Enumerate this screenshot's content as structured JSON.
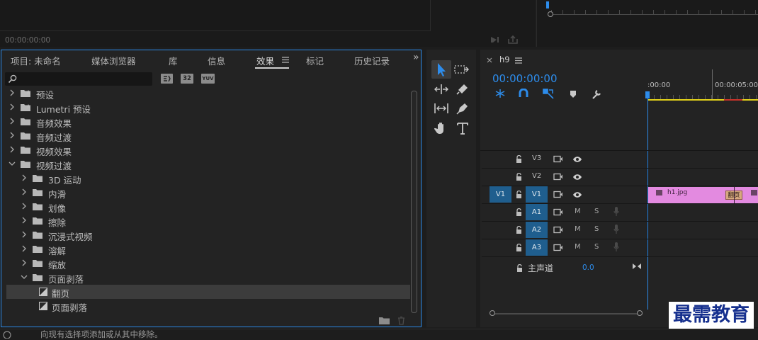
{
  "monitor": {
    "timecode": "00:00:00:00"
  },
  "effects_panel": {
    "tabs": [
      {
        "label": "项目: 未命名"
      },
      {
        "label": "媒体浏览器"
      },
      {
        "label": "库"
      },
      {
        "label": "信息"
      },
      {
        "label": "效果",
        "active": true
      },
      {
        "label": "标记"
      },
      {
        "label": "历史记录"
      }
    ],
    "more": "»",
    "search": {
      "value": "",
      "placeholder": ""
    },
    "filter_buttons": [
      "32",
      "YUV"
    ],
    "tree": [
      {
        "label": "预设",
        "level": 0,
        "expanded": false,
        "icon": "preset-folder-icon"
      },
      {
        "label": "Lumetri 预设",
        "level": 0,
        "expanded": false,
        "icon": "preset-folder-icon"
      },
      {
        "label": "音频效果",
        "level": 0,
        "expanded": false,
        "icon": "folder-icon"
      },
      {
        "label": "音频过渡",
        "level": 0,
        "expanded": false,
        "icon": "folder-icon"
      },
      {
        "label": "视频效果",
        "level": 0,
        "expanded": false,
        "icon": "folder-icon"
      },
      {
        "label": "视频过渡",
        "level": 0,
        "expanded": true,
        "icon": "folder-icon"
      },
      {
        "label": "3D 运动",
        "level": 1,
        "expanded": false,
        "icon": "folder-icon"
      },
      {
        "label": "内滑",
        "level": 1,
        "expanded": false,
        "icon": "folder-icon"
      },
      {
        "label": "划像",
        "level": 1,
        "expanded": false,
        "icon": "folder-icon"
      },
      {
        "label": "擦除",
        "level": 1,
        "expanded": false,
        "icon": "folder-icon"
      },
      {
        "label": "沉浸式视频",
        "level": 1,
        "expanded": false,
        "icon": "folder-icon"
      },
      {
        "label": "溶解",
        "level": 1,
        "expanded": false,
        "icon": "folder-icon"
      },
      {
        "label": "缩放",
        "level": 1,
        "expanded": false,
        "icon": "folder-icon"
      },
      {
        "label": "页面剥落",
        "level": 1,
        "expanded": true,
        "icon": "folder-icon"
      },
      {
        "label": "翻页",
        "level": 2,
        "icon": "transition-icon",
        "selected": true
      },
      {
        "label": "页面剥落",
        "level": 2,
        "icon": "transition-icon"
      }
    ]
  },
  "timeline": {
    "sequence_name": "h9",
    "timecode": "00:00:00:00",
    "ruler": [
      ":00:00",
      "00:00:05:00"
    ],
    "video_tracks": [
      {
        "name": "V3"
      },
      {
        "name": "V2"
      },
      {
        "name": "V1",
        "source": "V1"
      }
    ],
    "audio_tracks": [
      {
        "name": "A1",
        "mute": "M",
        "solo": "S"
      },
      {
        "name": "A2",
        "mute": "M",
        "solo": "S"
      },
      {
        "name": "A3",
        "mute": "M",
        "solo": "S"
      }
    ],
    "master": {
      "label": "主声道",
      "value": "0.0"
    },
    "clip": {
      "name": "h1.jpg",
      "transition": "翻页",
      "color": "#e38ae0"
    }
  },
  "status_bar": {
    "text": "向现有选择项添加或从其中移除。"
  },
  "watermark": "最需教育",
  "colors": {
    "accent": "#2d8ceb",
    "track_button": "#1f5e8e",
    "clip": "#e38ae0",
    "playhead": "#2d8ceb"
  }
}
